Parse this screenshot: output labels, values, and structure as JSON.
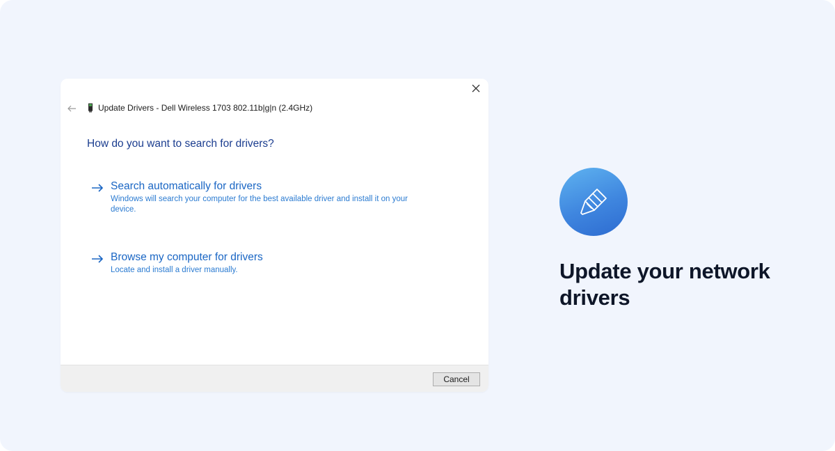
{
  "dialog": {
    "title": "Update Drivers - Dell Wireless 1703 802.11b|g|n (2.4GHz)",
    "question": "How do you want to search for drivers?",
    "options": [
      {
        "title": "Search automatically for drivers",
        "description": "Windows will search your computer for the best available driver and install it on your device."
      },
      {
        "title": "Browse my computer for drivers",
        "description": "Locate and install a driver manually."
      }
    ],
    "cancel_label": "Cancel",
    "icons": {
      "close": "close-icon",
      "back": "back-arrow-icon",
      "device": "network-adapter-icon",
      "option_arrow": "arrow-right-icon"
    }
  },
  "feature": {
    "icon": "ethernet-cable-icon",
    "headline": "Update your network drivers"
  },
  "colors": {
    "background": "#f1f5fd",
    "link_blue": "#1a66c4",
    "heading_blue": "#1b3d8f",
    "icon_gradient_start": "#5fb3f0",
    "icon_gradient_end": "#2d6bd0",
    "headline": "#0e1628"
  }
}
